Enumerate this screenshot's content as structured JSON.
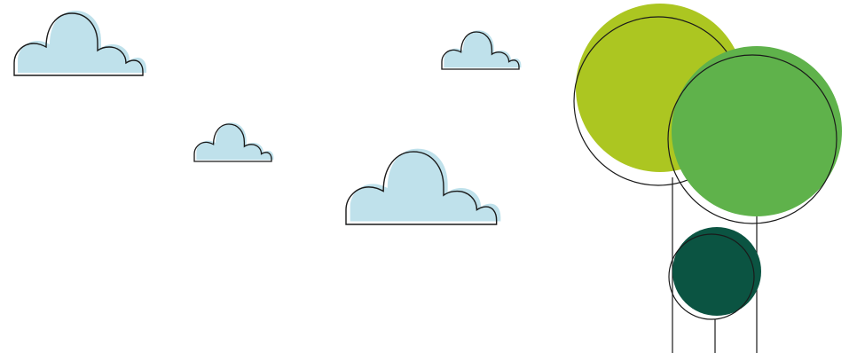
{
  "illustration": {
    "background": "#ffffff",
    "cloud_fill": "#bfe1eb",
    "outline_color": "#1a1a1a",
    "tree_colors": {
      "lime": "#acc621",
      "green": "#5fb24b",
      "dark_green": "#0b5442"
    },
    "counts": {
      "clouds": 4,
      "trees": 3
    }
  }
}
